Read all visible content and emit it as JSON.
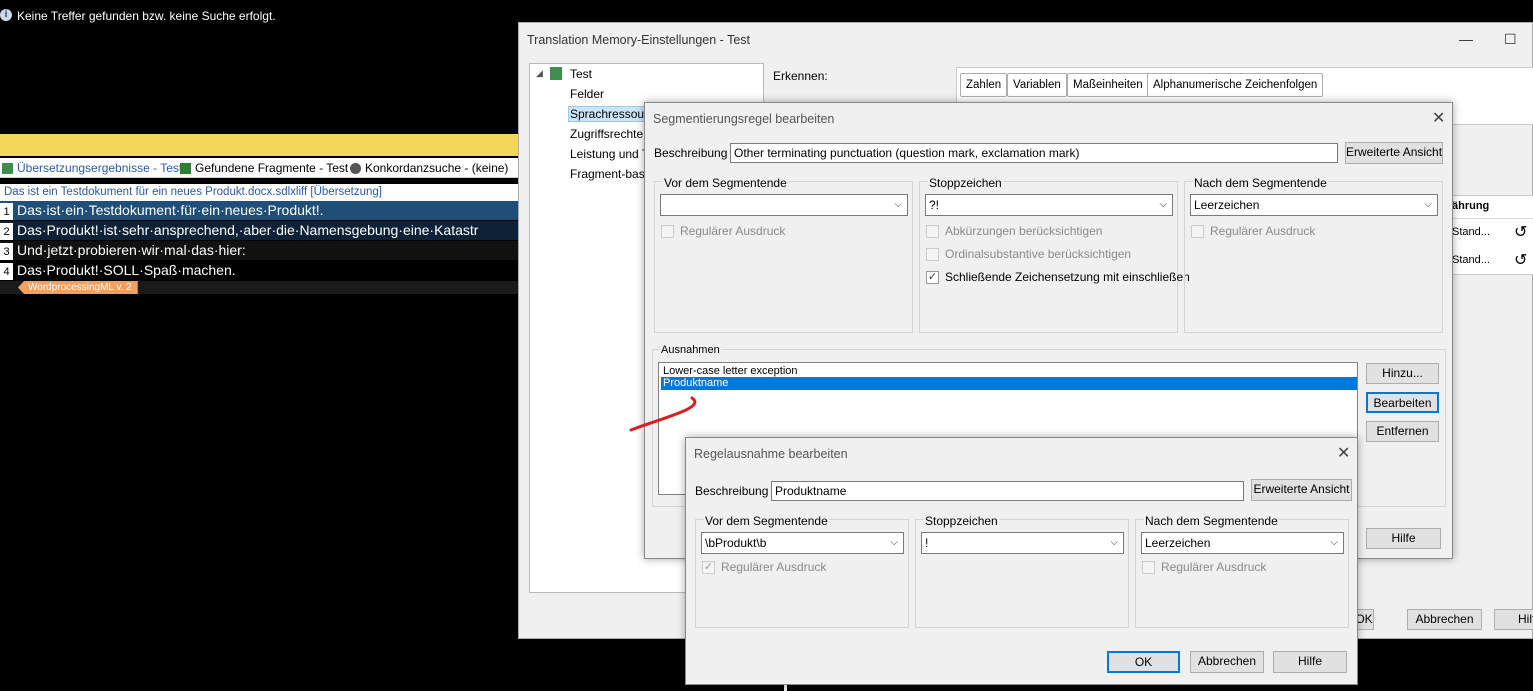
{
  "editor": {
    "info_text": "Keine Treffer gefunden bzw. keine Suche erfolgt.",
    "tabs": [
      "Übersetzungsergebnisse - Test",
      "Gefundene Fragmente - Test",
      "Konkordanzsuche - (keine)"
    ],
    "doc_header": "Das ist ein Testdokument für ein neues Produkt.docx.sdlxliff [Übersetzung]",
    "segments": [
      {
        "num": "1",
        "text": "Das·ist·ein·Testdokument·für·ein·neues·Produkt!."
      },
      {
        "num": "2",
        "text": "Das·Produkt!·ist·sehr·ansprechend,·aber·die·Namensgebung·eine·Katastr"
      },
      {
        "num": "3",
        "text": "Und·jetzt·probieren·wir·mal·das·hier:"
      },
      {
        "num": "4",
        "text": "Das·Produkt!·SOLL·Spaß·machen."
      }
    ],
    "tag": "WordprocessingML v. 2"
  },
  "tm_window": {
    "title": "Translation Memory-Einstellungen - Test",
    "tree": [
      "Test",
      "Felder",
      "Sprachressourc",
      "Zugriffsrechte",
      "Leistung und Tu",
      "Fragment-basie"
    ],
    "erkennen_label": "Erkennen:",
    "recognize_buttons": [
      "Zahlen",
      "Variablen",
      "Maßeinheiten",
      "Alphanumerische Zeichenfolgen"
    ],
    "table_header": "ährung",
    "table_rows": [
      "Stand...",
      "Stand..."
    ],
    "ok": "OK",
    "cancel": "Abbrechen",
    "help": "Hilf"
  },
  "seg_dialog": {
    "title": "Segmentierungsregel bearbeiten",
    "description_label": "Beschreibung",
    "description_value": "Other terminating punctuation (question mark, exclamation mark)",
    "advanced_button": "Erweiterte Ansicht",
    "before_group": "Vor dem Segmentende",
    "before_value": "",
    "before_regex": "Regulärer Ausdruck",
    "stop_group": "Stoppzeichen",
    "stop_value": "?!",
    "stop_abbr": "Abkürzungen berücksichtigen",
    "stop_ordinal": "Ordinalsubstantive berücksichtigen",
    "stop_closing": "Schließende Zeichensetzung mit einschließen",
    "after_group": "Nach dem Segmentende",
    "after_value": "Leerzeichen",
    "after_regex": "Regulärer Ausdruck",
    "exceptions_label": "Ausnahmen",
    "exceptions": [
      "Lower-case letter exception",
      "Produktname"
    ],
    "add_button": "Hinzu...",
    "edit_button": "Bearbeiten",
    "remove_button": "Entfernen",
    "help_button": "Hilfe"
  },
  "rule_dialog": {
    "title": "Regelausnahme bearbeiten",
    "description_label": "Beschreibung",
    "description_value": "Produktname",
    "advanced_button": "Erweiterte Ansicht",
    "before_group": "Vor dem Segmentende",
    "before_value": "\\bProdukt\\b",
    "before_regex": "Regulärer Ausdruck",
    "stop_group": "Stoppzeichen",
    "stop_value": "!",
    "after_group": "Nach dem Segmentende",
    "after_value": "Leerzeichen",
    "after_regex": "Regulärer Ausdruck",
    "ok": "OK",
    "cancel": "Abbrechen",
    "help": "Hilfe"
  }
}
